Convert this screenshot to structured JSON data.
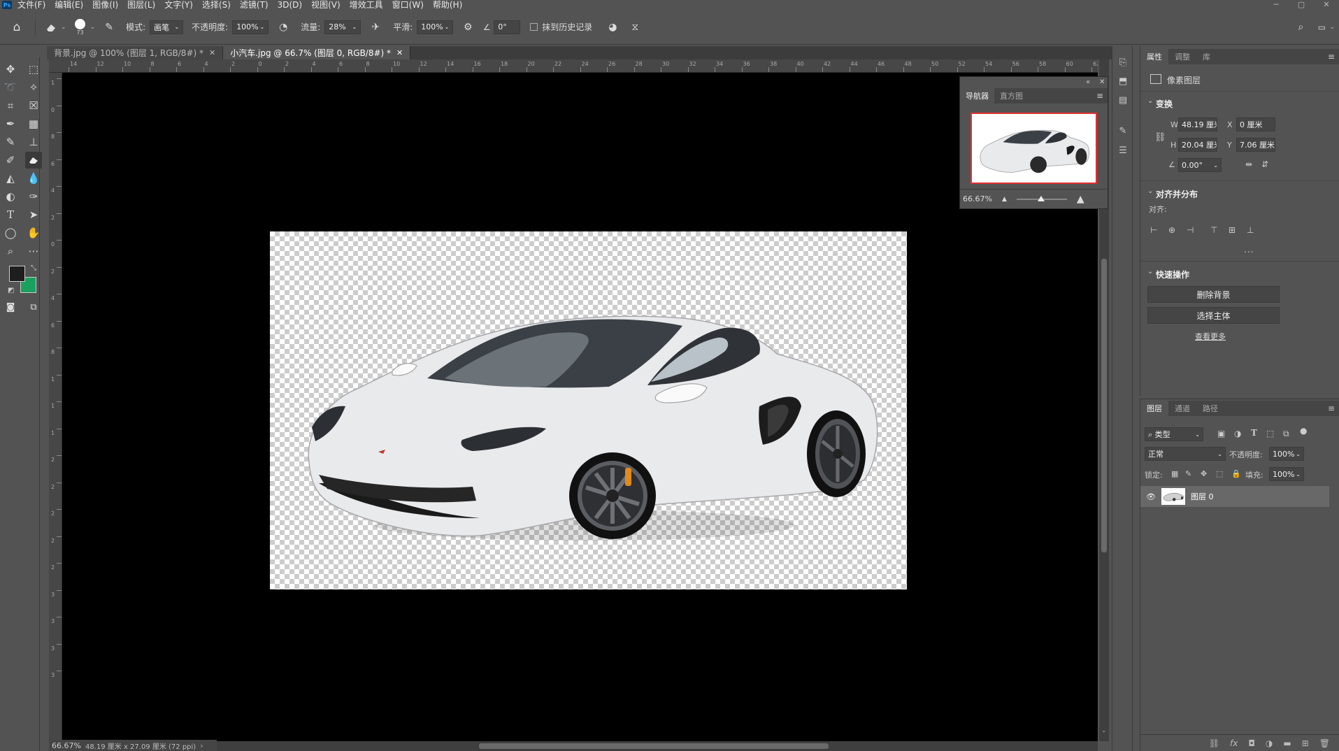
{
  "app": {
    "menu": [
      "文件(F)",
      "编辑(E)",
      "图像(I)",
      "图层(L)",
      "文字(Y)",
      "选择(S)",
      "滤镜(T)",
      "3D(D)",
      "视图(V)",
      "增效工具",
      "窗口(W)",
      "帮助(H)"
    ]
  },
  "options": {
    "brush_size": "73",
    "mode_label": "模式:",
    "mode_value": "画笔",
    "opacity_label": "不透明度:",
    "opacity_value": "100%",
    "flow_label": "流量:",
    "flow_value": "28%",
    "smooth_label": "平滑:",
    "smooth_value": "100%",
    "angle_value": "0°",
    "history_label": "抹到历史记录"
  },
  "tabs": [
    {
      "label": "背景.jpg @ 100% (图层 1, RGB/8#) *"
    },
    {
      "label": "小汽车.jpg @ 66.7% (图层 0, RGB/8#) *"
    }
  ],
  "ruler": {
    "h_ticks": [
      "14",
      "12",
      "10",
      "8",
      "6",
      "4",
      "2",
      "0",
      "2",
      "4",
      "6",
      "8",
      "10",
      "12",
      "14",
      "16",
      "18",
      "20",
      "22",
      "24",
      "26",
      "28",
      "30",
      "32",
      "34",
      "36",
      "38",
      "40",
      "42",
      "44",
      "46",
      "48",
      "50",
      "52",
      "54",
      "56",
      "58",
      "60",
      "62"
    ],
    "v_ticks": [
      "1",
      "0",
      "8",
      "6",
      "4",
      "2",
      "0",
      "2",
      "4",
      "6",
      "8",
      "1",
      "1",
      "1",
      "2",
      "2",
      "2",
      "2",
      "2",
      "3",
      "3",
      "3",
      "3"
    ]
  },
  "status": {
    "zoom": "66.67%",
    "doc_info": "48.19 厘米 x 27.09 厘米 (72 ppi)"
  },
  "navigator": {
    "tab1": "导航器",
    "tab2": "直方图",
    "zoom": "66.67%"
  },
  "properties": {
    "tabs": [
      "属性",
      "调整",
      "库"
    ],
    "layer_type": "像素图层",
    "transform_title": "变换",
    "w_label": "W",
    "w_value": "48.19 厘米",
    "x_label": "X",
    "x_value": "0 厘米",
    "h_label": "H",
    "h_value": "20.04 厘米",
    "y_label": "Y",
    "y_value": "7.06 厘米",
    "angle_value": "0.00°",
    "align_title": "对齐并分布",
    "align_label": "对齐:",
    "more_dots": "...",
    "quick_title": "快速操作",
    "remove_bg": "删除背景",
    "select_subject": "选择主体",
    "see_more": "查看更多"
  },
  "layers": {
    "tabs": [
      "图层",
      "通道",
      "路径"
    ],
    "filter_label": "类型",
    "blend_mode": "正常",
    "opacity_label": "不透明度:",
    "opacity_value": "100%",
    "lock_label": "锁定:",
    "fill_label": "填充:",
    "fill_value": "100%",
    "layer_name": "图层 0"
  },
  "colors": {
    "foreground": "#1e1e1e",
    "background": "#1aa05f",
    "accent": "#e23030"
  }
}
